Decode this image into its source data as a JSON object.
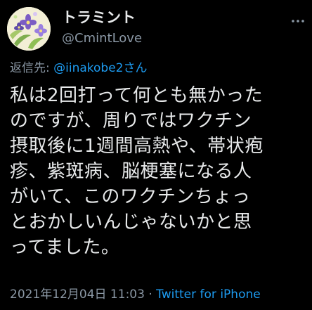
{
  "author": {
    "display_name": "トラミント",
    "handle": "@CmintLove",
    "avatar_icon": "flower-illustration-icon"
  },
  "reply": {
    "prefix": "返信先: ",
    "mention": "@iinakobe2さん"
  },
  "tweet": {
    "lines": [
      "私は2回打って何とも無かった",
      "のですが、周りではワクチン",
      "摂取後に1週間高熱や、帯状疱",
      "疹、紫斑病、脳梗塞になる人",
      "がいて、このワクチンちょっ",
      "とおかしいんじゃないかと思",
      "ってました。"
    ]
  },
  "meta": {
    "timestamp": "2021年12月04日 11:03",
    "separator": " · ",
    "source": "Twitter for iPhone"
  },
  "colors": {
    "background": "#000000",
    "text": "#e7e9ea",
    "secondary": "#8b98a5",
    "accent": "#1d9bf0"
  }
}
